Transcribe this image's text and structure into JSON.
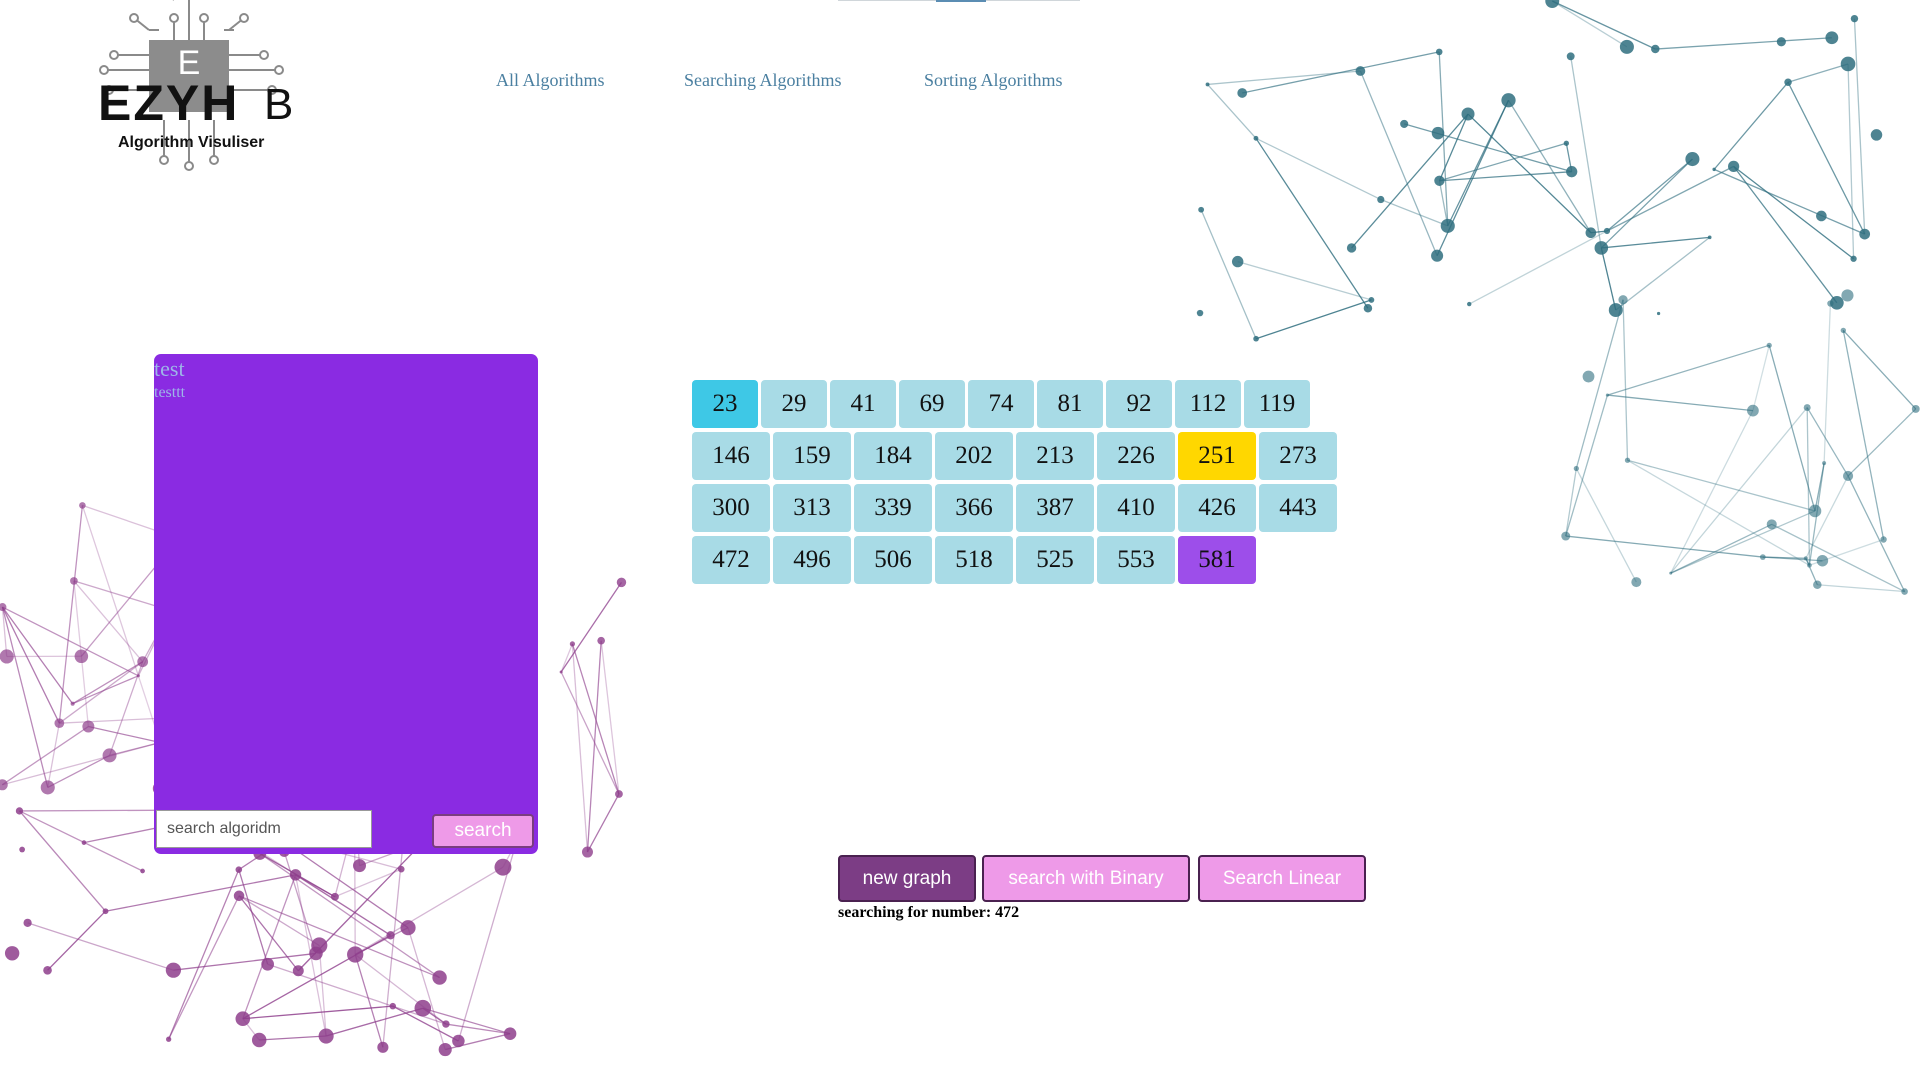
{
  "logo": {
    "letter": "E",
    "word": "EZYH",
    "word_end": "B",
    "subtitle": "Algorithm Visuliser"
  },
  "nav": {
    "items": [
      "All Algorithms",
      "Searching Algorithms",
      "Sorting Algorithms"
    ]
  },
  "panel": {
    "title": "test",
    "subtitle": "testtt",
    "search_placeholder": "search algoridm",
    "search_button": "search",
    "bg_color": "#8a2be2"
  },
  "array": {
    "rows": [
      [
        "23",
        "29",
        "41",
        "69",
        "74",
        "81",
        "92",
        "112",
        "119"
      ],
      [
        "146",
        "159",
        "184",
        "202",
        "213",
        "226",
        "251",
        "273"
      ],
      [
        "300",
        "313",
        "339",
        "366",
        "387",
        "410",
        "426",
        "443"
      ],
      [
        "472",
        "496",
        "506",
        "518",
        "525",
        "553",
        "581"
      ]
    ],
    "highlights": {
      "23": "#3ec8e6",
      "251": "#ffd700",
      "581": "#9d4eea"
    },
    "default_color": "#a8dbe6"
  },
  "controls": {
    "new_graph": "new graph",
    "binary": "search with Binary",
    "linear": "Search Linear"
  },
  "status": {
    "text": "searching for number: 472"
  },
  "colors": {
    "nav": "#4a7fa0",
    "network_teal": "#2f6e7f",
    "network_purple": "#8e3e8c"
  }
}
